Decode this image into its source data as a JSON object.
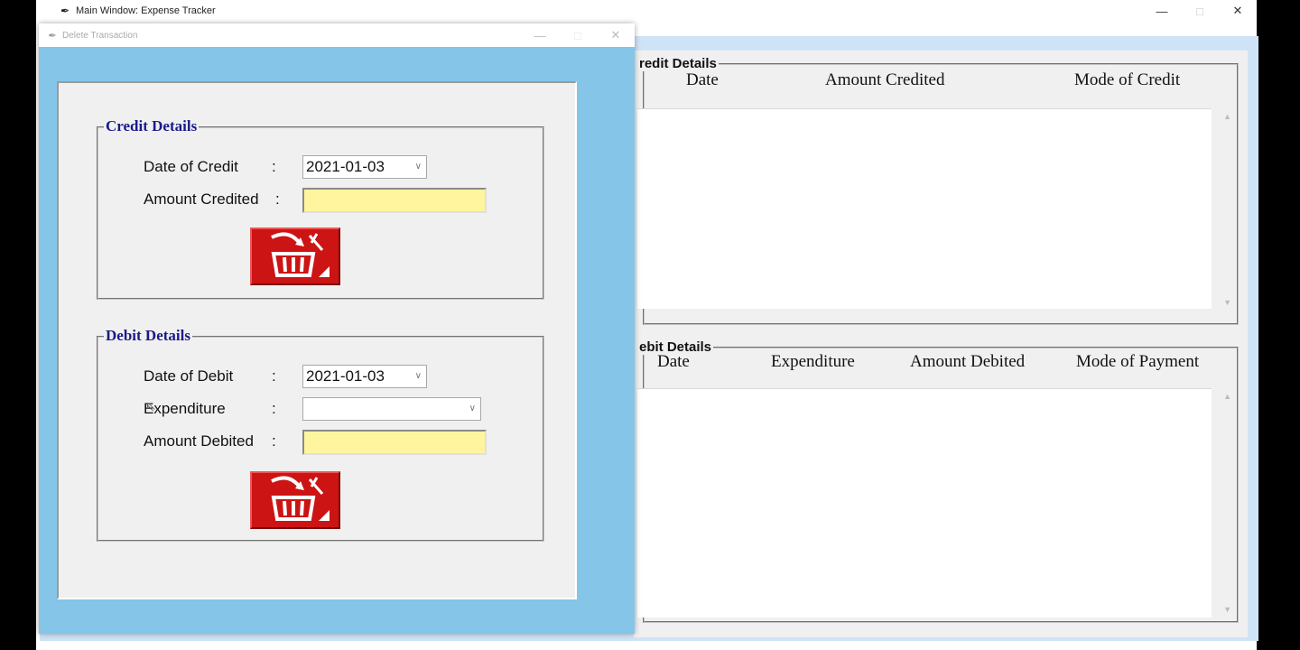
{
  "main_window": {
    "title": "Main Window: Expense Tracker",
    "controls": {
      "minimize": "—",
      "maximize": "□",
      "close": "✕"
    },
    "credit_group": {
      "legend": "redit Details",
      "columns": [
        "Date",
        "Amount Credited",
        "Mode of Credit"
      ]
    },
    "debit_group": {
      "legend": "ebit Details",
      "columns": [
        "Date",
        "Expenditure",
        "Amount Debited",
        "Mode of Payment"
      ]
    }
  },
  "dialog": {
    "title": "Delete Transaction",
    "controls": {
      "minimize": "—",
      "maximize": "□",
      "close": "✕"
    },
    "credit": {
      "legend": "Credit Details",
      "date_label": "Date of Credit",
      "date_value": "2021-01-03",
      "amount_label": "Amount Credited",
      "amount_value": "",
      "colon": ":"
    },
    "debit": {
      "legend": "Debit Details",
      "date_label": "Date of Debit",
      "date_value": "2021-01-03",
      "expenditure_label": "Expenditure",
      "expenditure_value": "",
      "amount_label": "Amount Debited",
      "amount_value": "",
      "colon": ":"
    }
  },
  "colors": {
    "dialog_bg": "#85c5e8",
    "entry_bg": "#fff59e",
    "delete_button": "#cc1414",
    "legend_blue": "#1a1a8a"
  },
  "icons": {
    "app": "feather-icon",
    "back": "back-arrow-icon",
    "delete": "trash-basket-icon",
    "dropdown": "chevron-down-icon"
  }
}
